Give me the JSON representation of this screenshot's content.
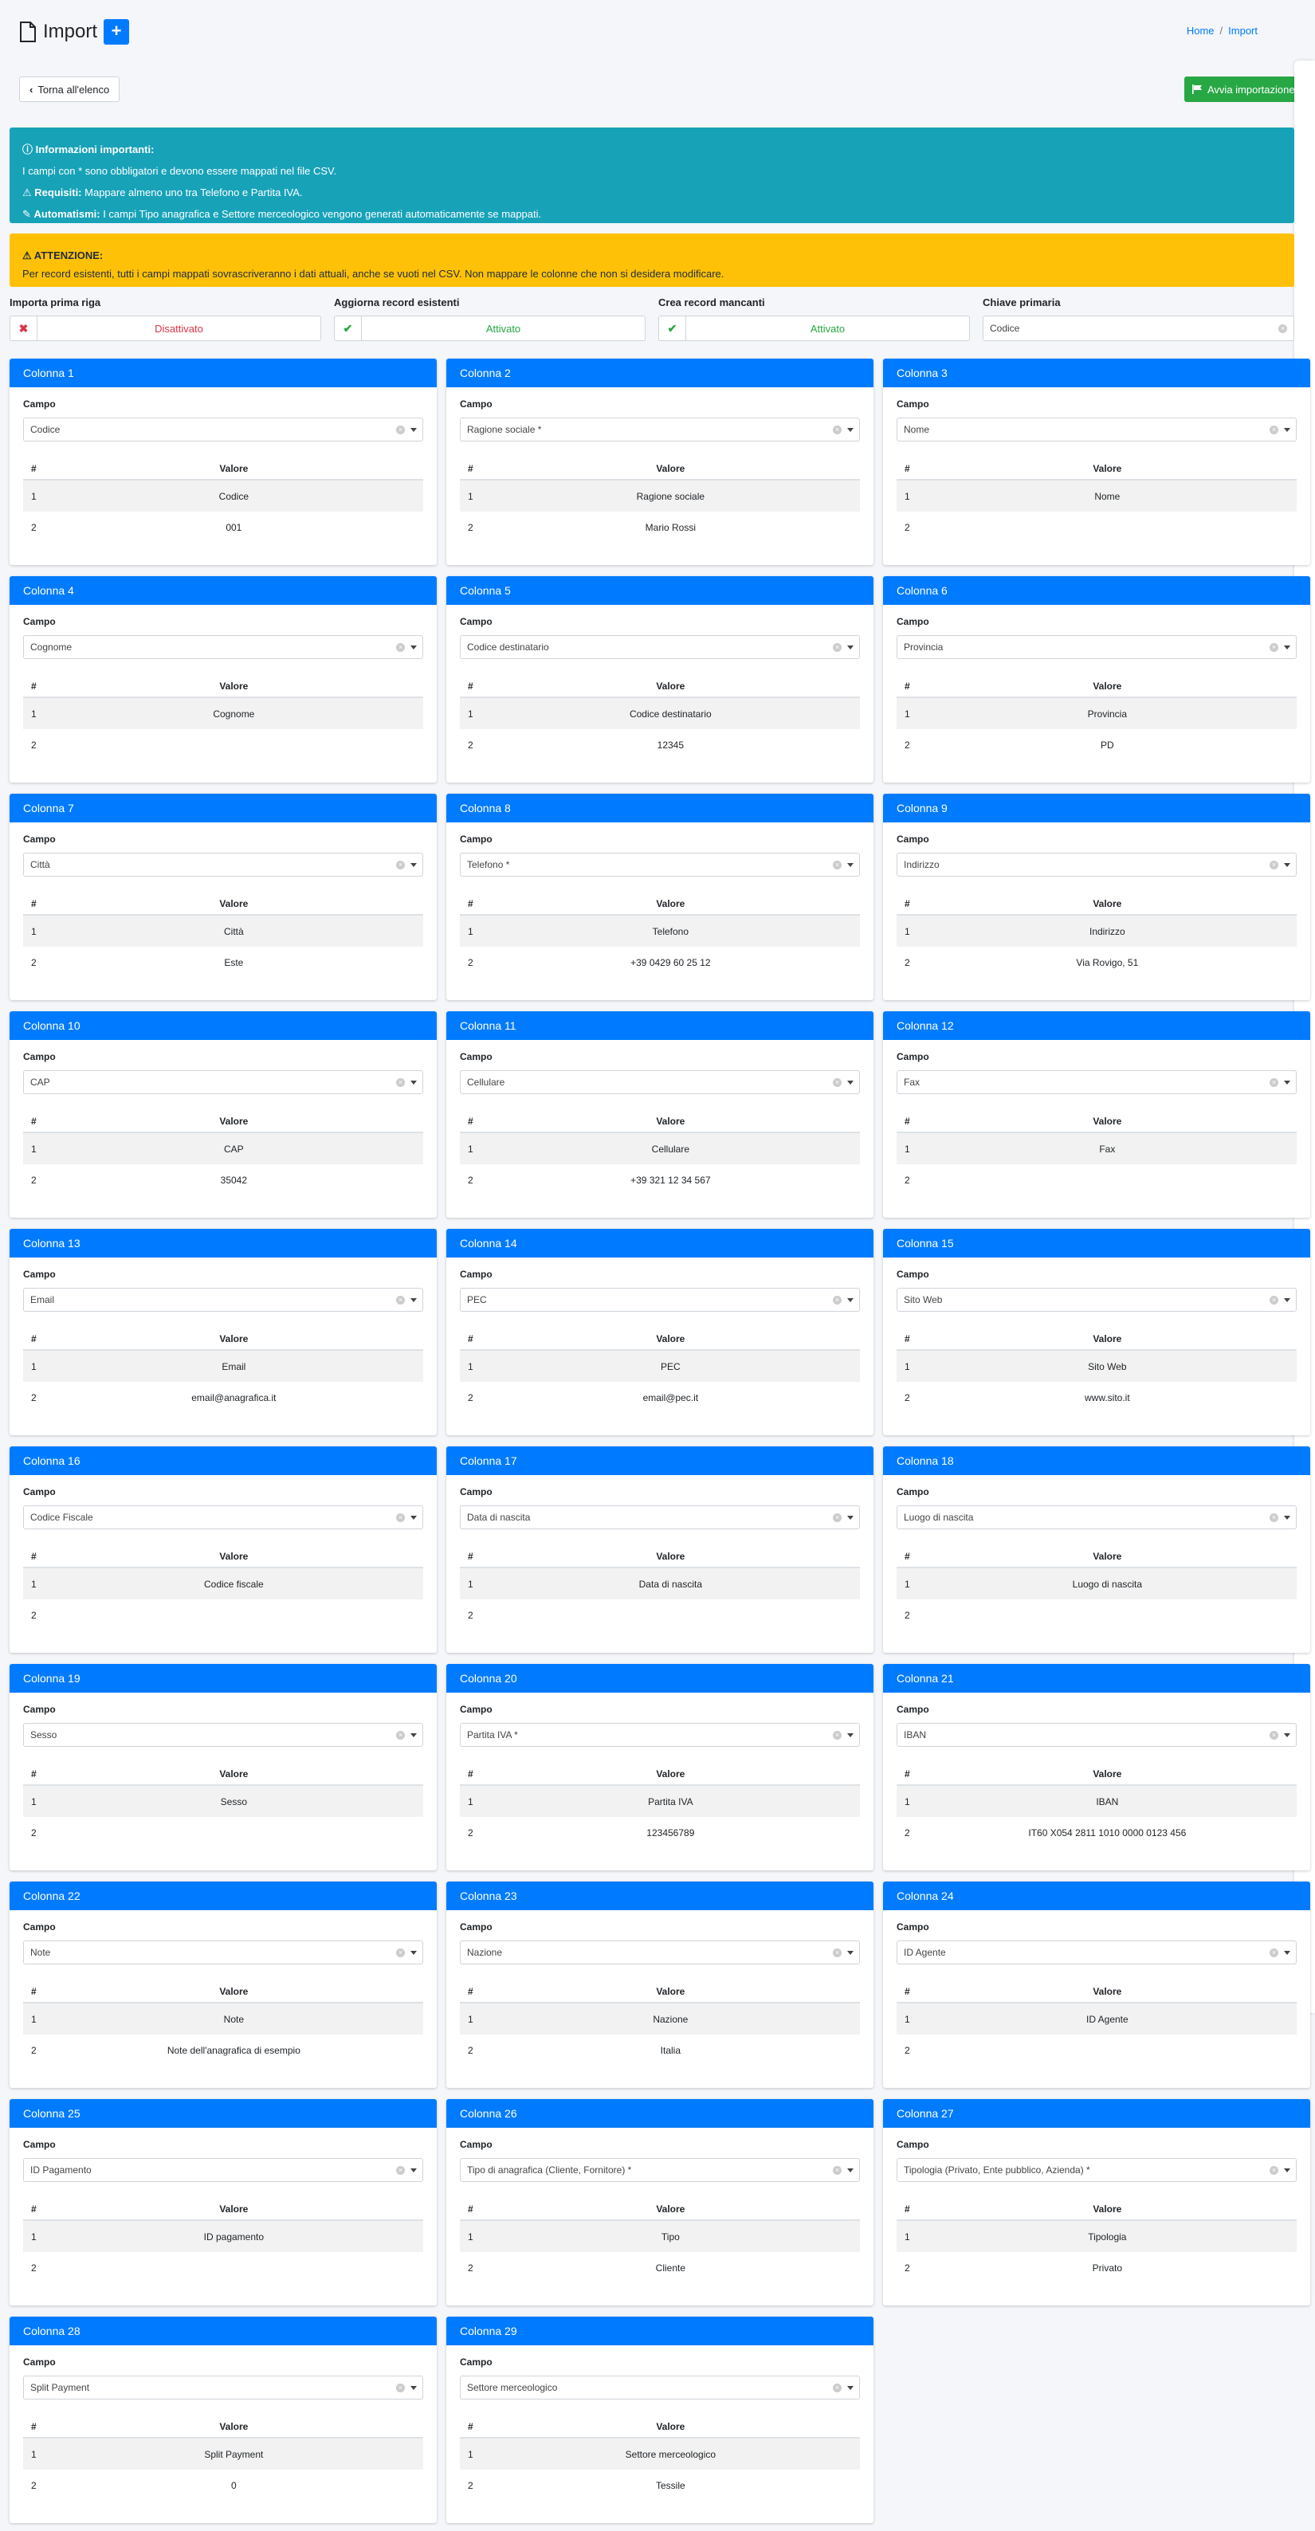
{
  "page": {
    "title": "Import"
  },
  "breadcrumb": [
    "Home",
    "Import"
  ],
  "toolbar": {
    "back_label": "Torna all'elenco",
    "start_label": "Avvia importazione"
  },
  "info_alert": {
    "heading": "Informazioni importanti:",
    "line1": "I campi con * sono obbligatori e devono essere mappati nel file CSV.",
    "requisiti_label": "Requisiti:",
    "requisiti_text": "Mappare almeno uno tra Telefono e Partita IVA.",
    "automatismi_label": "Automatismi:",
    "automatismi_text": "I campi Tipo anagrafica e Settore merceologico vengono generati automaticamente se mappati."
  },
  "warning_alert": {
    "heading": "ATTENZIONE:",
    "text": "Per record esistenti, tutti i campi mappati sovrascriveranno i dati attuali, anche se vuoti nel CSV. Non mappare le colonne che non si desidera modificare."
  },
  "options": [
    {
      "label": "Importa prima riga",
      "value": "Disattivato",
      "state": "off"
    },
    {
      "label": "Aggiorna record esistenti",
      "value": "Attivato",
      "state": "on"
    },
    {
      "label": "Crea record mancanti",
      "value": "Attivato",
      "state": "on"
    },
    {
      "label": "Chiave primaria",
      "value": "Codice",
      "state": "select"
    }
  ],
  "labels": {
    "field": "Campo",
    "col_num": "#",
    "col_value": "Valore"
  },
  "columns": [
    {
      "title": "Colonna 1",
      "field": "Codice",
      "rows": [
        [
          "1",
          "Codice"
        ],
        [
          "2",
          "001"
        ]
      ]
    },
    {
      "title": "Colonna 2",
      "field": "Ragione sociale *",
      "rows": [
        [
          "1",
          "Ragione sociale"
        ],
        [
          "2",
          "Mario Rossi"
        ]
      ]
    },
    {
      "title": "Colonna 3",
      "field": "Nome",
      "rows": [
        [
          "1",
          "Nome"
        ],
        [
          "2",
          ""
        ]
      ]
    },
    {
      "title": "Colonna 4",
      "field": "Cognome",
      "rows": [
        [
          "1",
          "Cognome"
        ],
        [
          "2",
          ""
        ]
      ]
    },
    {
      "title": "Colonna 5",
      "field": "Codice destinatario",
      "rows": [
        [
          "1",
          "Codice destinatario"
        ],
        [
          "2",
          "12345"
        ]
      ]
    },
    {
      "title": "Colonna 6",
      "field": "Provincia",
      "rows": [
        [
          "1",
          "Provincia"
        ],
        [
          "2",
          "PD"
        ]
      ]
    },
    {
      "title": "Colonna 7",
      "field": "Città",
      "rows": [
        [
          "1",
          "Città"
        ],
        [
          "2",
          "Este"
        ]
      ]
    },
    {
      "title": "Colonna 8",
      "field": "Telefono *",
      "rows": [
        [
          "1",
          "Telefono"
        ],
        [
          "2",
          "+39 0429 60 25 12"
        ]
      ]
    },
    {
      "title": "Colonna 9",
      "field": "Indirizzo",
      "rows": [
        [
          "1",
          "Indirizzo"
        ],
        [
          "2",
          "Via Rovigo, 51"
        ]
      ]
    },
    {
      "title": "Colonna 10",
      "field": "CAP",
      "rows": [
        [
          "1",
          "CAP"
        ],
        [
          "2",
          "35042"
        ]
      ]
    },
    {
      "title": "Colonna 11",
      "field": "Cellulare",
      "rows": [
        [
          "1",
          "Cellulare"
        ],
        [
          "2",
          "+39 321 12 34 567"
        ]
      ]
    },
    {
      "title": "Colonna 12",
      "field": "Fax",
      "rows": [
        [
          "1",
          "Fax"
        ],
        [
          "2",
          ""
        ]
      ]
    },
    {
      "title": "Colonna 13",
      "field": "Email",
      "rows": [
        [
          "1",
          "Email"
        ],
        [
          "2",
          "email@anagrafica.it"
        ]
      ]
    },
    {
      "title": "Colonna 14",
      "field": "PEC",
      "rows": [
        [
          "1",
          "PEC"
        ],
        [
          "2",
          "email@pec.it"
        ]
      ]
    },
    {
      "title": "Colonna 15",
      "field": "Sito Web",
      "rows": [
        [
          "1",
          "Sito Web"
        ],
        [
          "2",
          "www.sito.it"
        ]
      ]
    },
    {
      "title": "Colonna 16",
      "field": "Codice Fiscale",
      "rows": [
        [
          "1",
          "Codice fiscale"
        ],
        [
          "2",
          ""
        ]
      ]
    },
    {
      "title": "Colonna 17",
      "field": "Data di nascita",
      "rows": [
        [
          "1",
          "Data di nascita"
        ],
        [
          "2",
          ""
        ]
      ]
    },
    {
      "title": "Colonna 18",
      "field": "Luogo di nascita",
      "rows": [
        [
          "1",
          "Luogo di nascita"
        ],
        [
          "2",
          ""
        ]
      ]
    },
    {
      "title": "Colonna 19",
      "field": "Sesso",
      "rows": [
        [
          "1",
          "Sesso"
        ],
        [
          "2",
          ""
        ]
      ]
    },
    {
      "title": "Colonna 20",
      "field": "Partita IVA *",
      "rows": [
        [
          "1",
          "Partita IVA"
        ],
        [
          "2",
          "123456789"
        ]
      ]
    },
    {
      "title": "Colonna 21",
      "field": "IBAN",
      "rows": [
        [
          "1",
          "IBAN"
        ],
        [
          "2",
          "IT60 X054 2811 1010 0000 0123 456"
        ]
      ]
    },
    {
      "title": "Colonna 22",
      "field": "Note",
      "rows": [
        [
          "1",
          "Note"
        ],
        [
          "2",
          "Note dell'anagrafica di esempio"
        ]
      ]
    },
    {
      "title": "Colonna 23",
      "field": "Nazione",
      "rows": [
        [
          "1",
          "Nazione"
        ],
        [
          "2",
          "Italia"
        ]
      ]
    },
    {
      "title": "Colonna 24",
      "field": "ID Agente",
      "rows": [
        [
          "1",
          "ID Agente"
        ],
        [
          "2",
          ""
        ]
      ]
    },
    {
      "title": "Colonna 25",
      "field": "ID Pagamento",
      "rows": [
        [
          "1",
          "ID pagamento"
        ],
        [
          "2",
          ""
        ]
      ]
    },
    {
      "title": "Colonna 26",
      "field": "Tipo di anagrafica (Cliente, Fornitore) *",
      "rows": [
        [
          "1",
          "Tipo"
        ],
        [
          "2",
          "Cliente"
        ]
      ]
    },
    {
      "title": "Colonna 27",
      "field": "Tipologia (Privato, Ente pubblico, Azienda) *",
      "rows": [
        [
          "1",
          "Tipologia"
        ],
        [
          "2",
          "Privato"
        ]
      ]
    },
    {
      "title": "Colonna 28",
      "field": "Split Payment",
      "rows": [
        [
          "1",
          "Split Payment"
        ],
        [
          "2",
          "0"
        ]
      ]
    },
    {
      "title": "Colonna 29",
      "field": "Settore merceologico",
      "rows": [
        [
          "1",
          "Settore merceologico"
        ],
        [
          "2",
          "Tessile"
        ]
      ]
    }
  ],
  "colors": {
    "primary": "#007bff",
    "info": "#17a2b8",
    "warning": "#ffc107",
    "success": "#28a745",
    "danger": "#dc3545"
  },
  "icons": {
    "title": "file-icon",
    "add": "plus-icon",
    "back": "chevron-left-icon",
    "start": "flag-icon",
    "info": "info-circle-icon",
    "requisiti": "warning-icon",
    "automatismi": "magic-wand-icon",
    "warning": "warning-icon",
    "off": "times-icon",
    "on": "check-icon",
    "side": "chevron-left-icon"
  }
}
